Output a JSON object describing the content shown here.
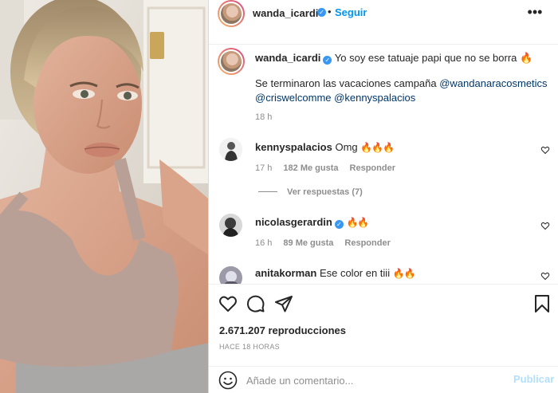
{
  "post": {
    "username": "wanda_icardi",
    "verified": true,
    "follow_label": "Seguir",
    "separator": "•",
    "more_icon": "more-horizontal-icon"
  },
  "caption": {
    "username": "wanda_icardi",
    "text": "Yo soy ese tatuaje papi que no se borra",
    "text_emoji": "🔥",
    "line2_text": "Se terminaron las vacaciones campaña ",
    "mentions": [
      "@wandanaracosmetics",
      "@criswelcomme",
      "@kennyspalacios"
    ],
    "time": "18 h"
  },
  "comments": [
    {
      "username": "kennyspalacios",
      "verified": false,
      "text": "Omg",
      "emoji": "🔥🔥🔥",
      "time": "17 h",
      "likes": "182 Me gusta",
      "reply_label": "Responder",
      "view_replies": "Ver respuestas (7)"
    },
    {
      "username": "nicolasgerardin",
      "verified": true,
      "text": "",
      "emoji": "🔥🔥",
      "time": "16 h",
      "likes": "89 Me gusta",
      "reply_label": "Responder"
    },
    {
      "username": "anitakorman",
      "verified": false,
      "text": "Ese color en tiii",
      "emoji": "🔥🔥"
    }
  ],
  "actions": {
    "icons": [
      "heart-icon",
      "comment-icon",
      "share-icon",
      "bookmark-icon"
    ],
    "views": "2.671.207 reproducciones",
    "time_ago": "HACE 18 HORAS"
  },
  "add_comment": {
    "placeholder": "Añade un comentario...",
    "publish_label": "Publicar"
  },
  "colors": {
    "accent": "#0095f6",
    "publish_disabled": "#b2dffc",
    "verified": "#3897f0",
    "mention": "#00376b",
    "muted": "#8e8e8e"
  }
}
